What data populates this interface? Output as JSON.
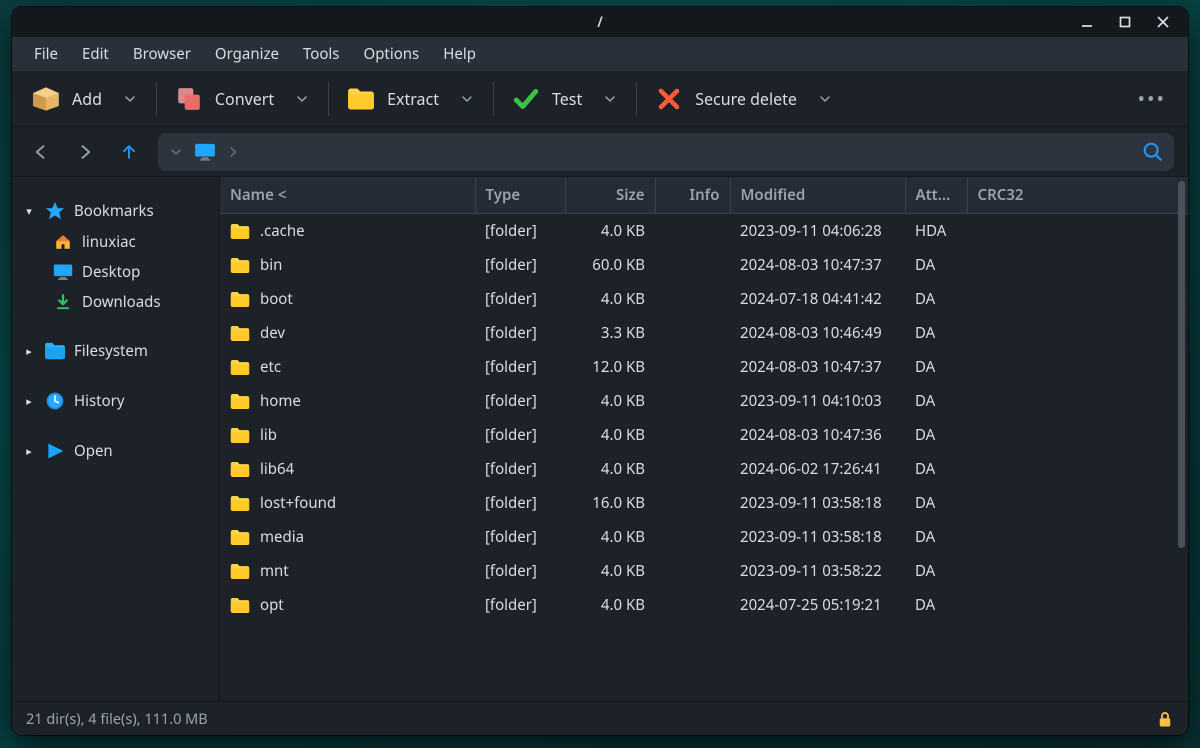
{
  "window": {
    "title": "/"
  },
  "menu": {
    "file": "File",
    "edit": "Edit",
    "browser": "Browser",
    "organize": "Organize",
    "tools": "Tools",
    "options": "Options",
    "help": "Help"
  },
  "toolbar": {
    "add": "Add",
    "convert": "Convert",
    "extract": "Extract",
    "test": "Test",
    "secure_delete": "Secure delete"
  },
  "sidebar": {
    "bookmarks": {
      "label": "Bookmarks",
      "items": [
        {
          "label": "linuxiac",
          "icon": "home"
        },
        {
          "label": "Desktop",
          "icon": "desktop"
        },
        {
          "label": "Downloads",
          "icon": "downloads"
        }
      ]
    },
    "filesystem": {
      "label": "Filesystem"
    },
    "history": {
      "label": "History"
    },
    "open": {
      "label": "Open"
    }
  },
  "columns": {
    "name": "Name <",
    "type": "Type",
    "size": "Size",
    "info": "Info",
    "modified": "Modified",
    "attributes": "Attributes",
    "crc32": "CRC32"
  },
  "files": [
    {
      "name": ".cache",
      "type": "[folder]",
      "size": "4.0 KB",
      "info": "",
      "modified": "2023-09-11 04:06:28",
      "attr": "HDA"
    },
    {
      "name": "bin",
      "type": "[folder]",
      "size": "60.0 KB",
      "info": "",
      "modified": "2024-08-03 10:47:37",
      "attr": "DA"
    },
    {
      "name": "boot",
      "type": "[folder]",
      "size": "4.0 KB",
      "info": "",
      "modified": "2024-07-18 04:41:42",
      "attr": "DA"
    },
    {
      "name": "dev",
      "type": "[folder]",
      "size": "3.3 KB",
      "info": "",
      "modified": "2024-08-03 10:46:49",
      "attr": "DA"
    },
    {
      "name": "etc",
      "type": "[folder]",
      "size": "12.0 KB",
      "info": "",
      "modified": "2024-08-03 10:47:37",
      "attr": "DA"
    },
    {
      "name": "home",
      "type": "[folder]",
      "size": "4.0 KB",
      "info": "",
      "modified": "2023-09-11 04:10:03",
      "attr": "DA"
    },
    {
      "name": "lib",
      "type": "[folder]",
      "size": "4.0 KB",
      "info": "",
      "modified": "2024-08-03 10:47:36",
      "attr": "DA"
    },
    {
      "name": "lib64",
      "type": "[folder]",
      "size": "4.0 KB",
      "info": "",
      "modified": "2024-06-02 17:26:41",
      "attr": "DA"
    },
    {
      "name": "lost+found",
      "type": "[folder]",
      "size": "16.0 KB",
      "info": "",
      "modified": "2023-09-11 03:58:18",
      "attr": "DA"
    },
    {
      "name": "media",
      "type": "[folder]",
      "size": "4.0 KB",
      "info": "",
      "modified": "2023-09-11 03:58:18",
      "attr": "DA"
    },
    {
      "name": "mnt",
      "type": "[folder]",
      "size": "4.0 KB",
      "info": "",
      "modified": "2023-09-11 03:58:22",
      "attr": "DA"
    },
    {
      "name": "opt",
      "type": "[folder]",
      "size": "4.0 KB",
      "info": "",
      "modified": "2024-07-25 05:19:21",
      "attr": "DA"
    }
  ],
  "status": {
    "text": "21 dir(s), 4 file(s), 111.0 MB"
  }
}
